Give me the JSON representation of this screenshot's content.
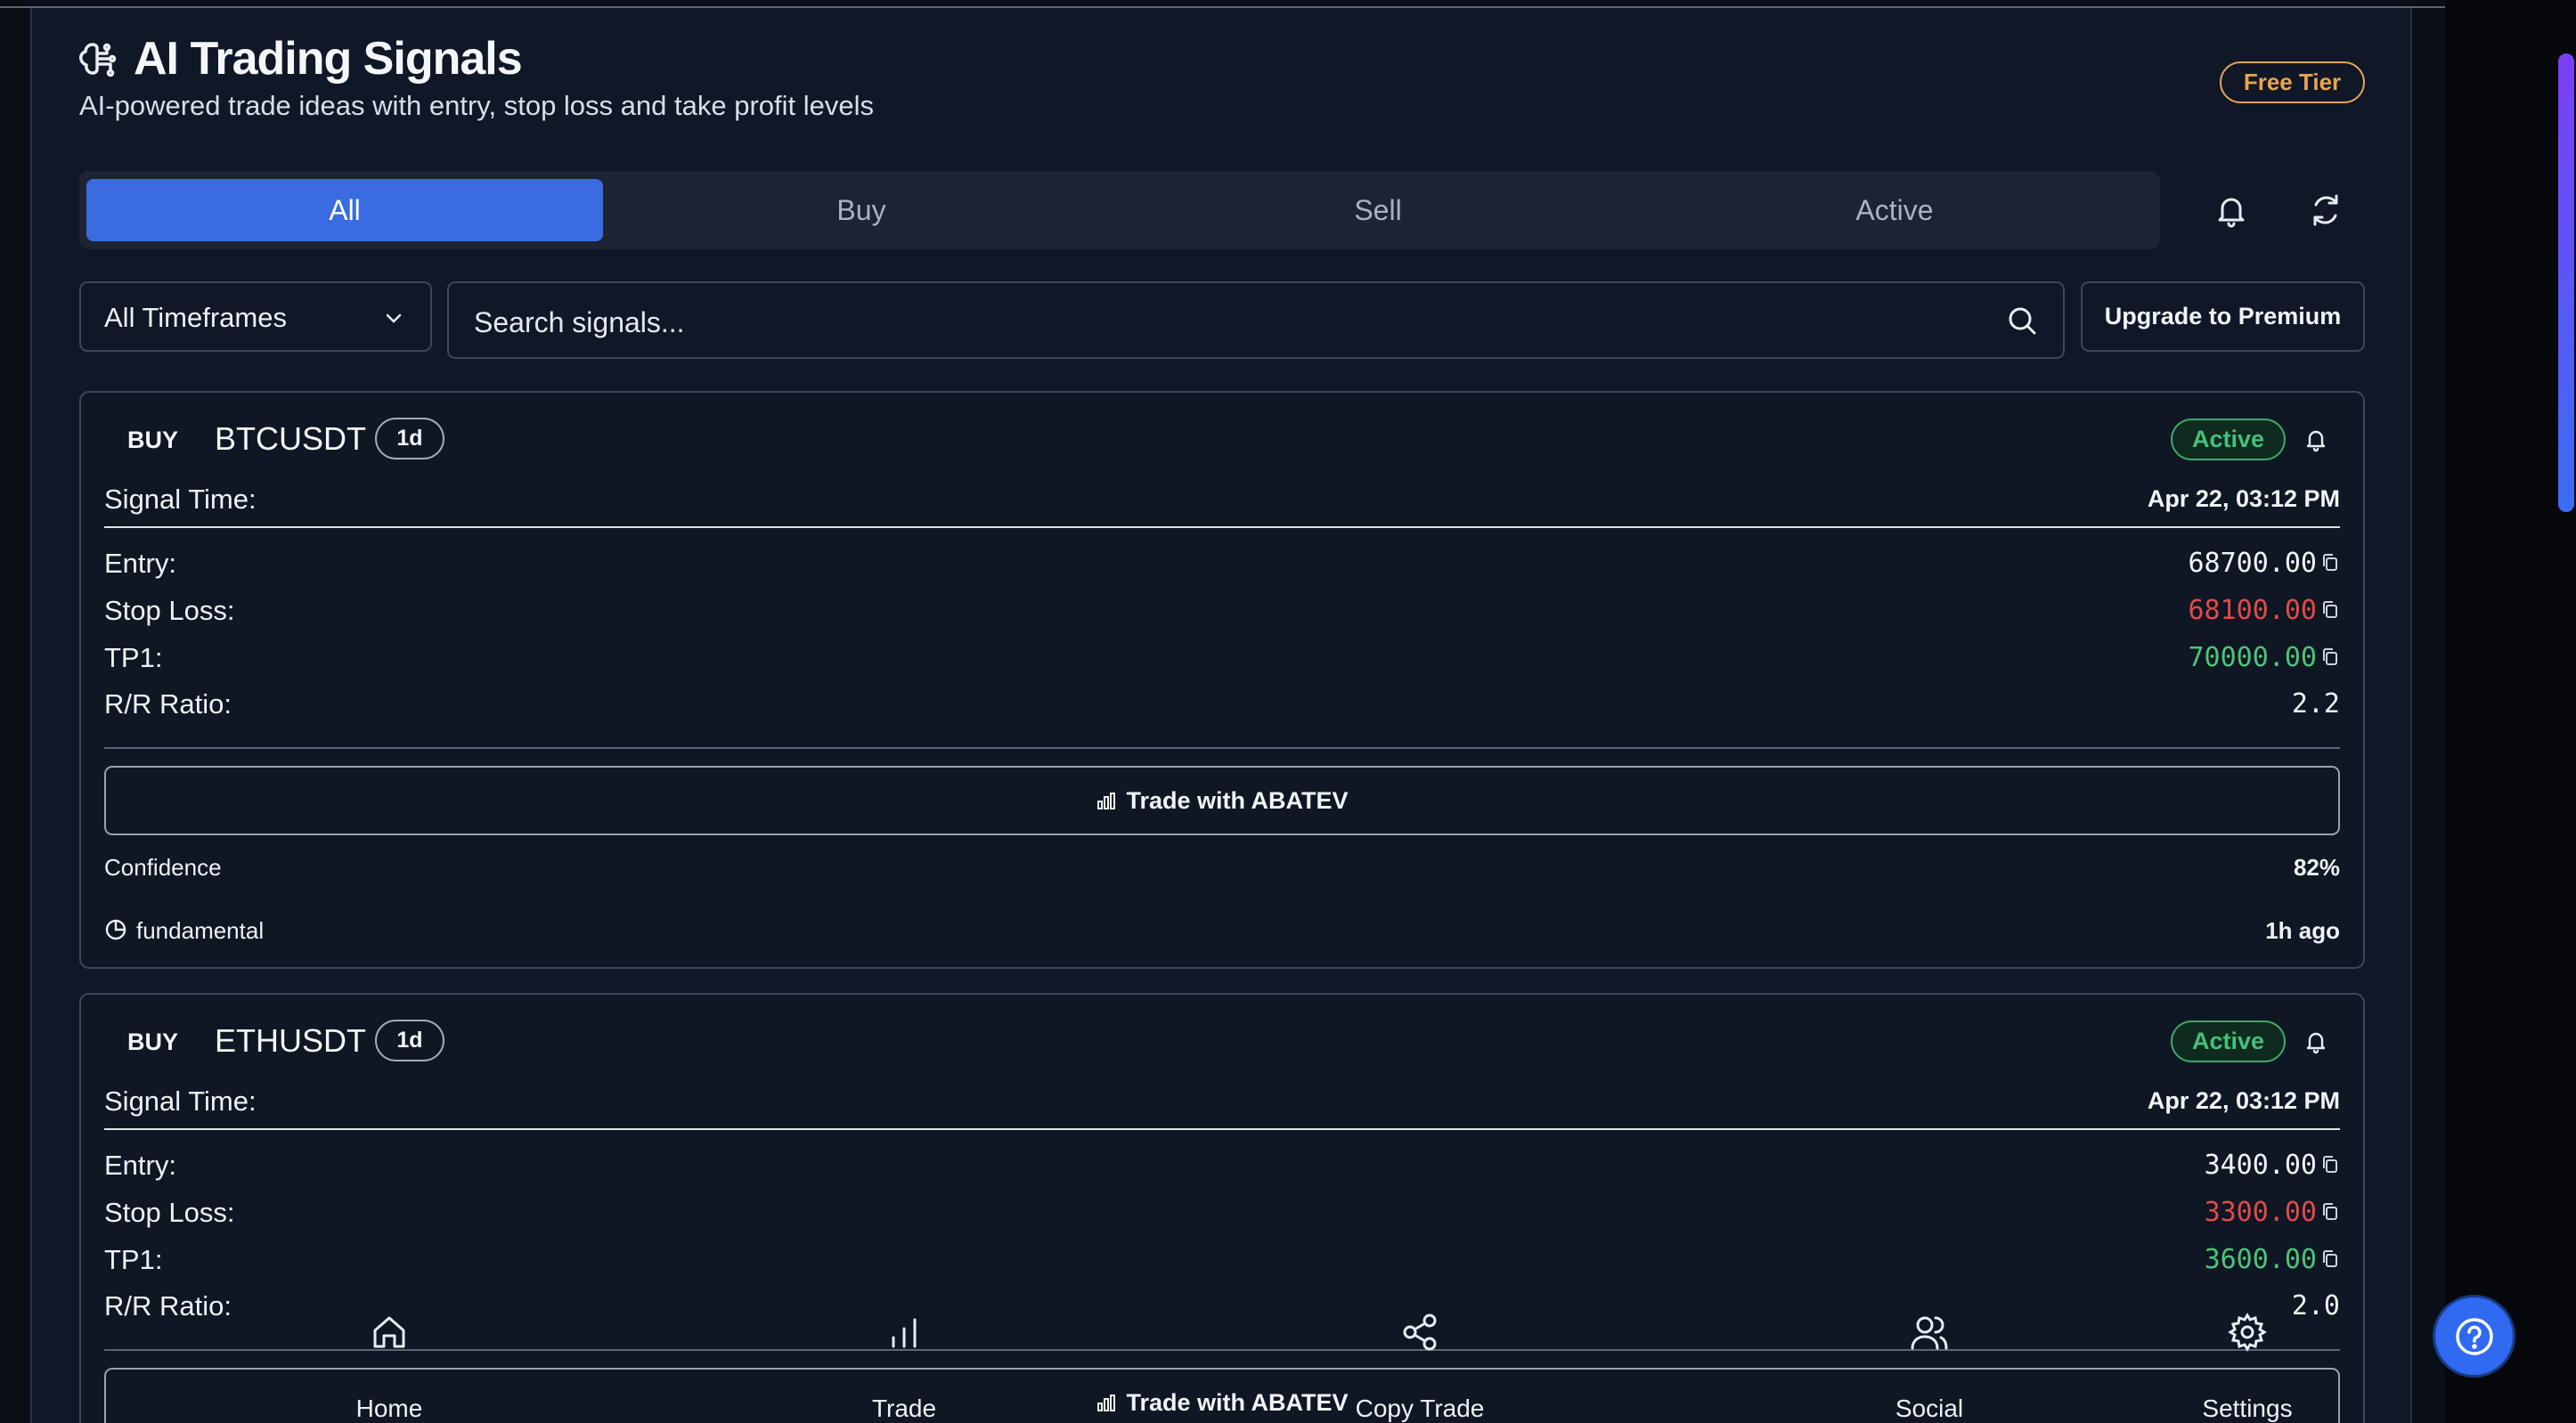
{
  "header": {
    "title": "AI Trading Signals",
    "subtitle": "AI-powered trade ideas with entry, stop loss and take profit levels",
    "tier_badge": "Free Tier",
    "title_icon": "brain-icon"
  },
  "tabs": [
    {
      "label": "All",
      "active": true
    },
    {
      "label": "Buy",
      "active": false
    },
    {
      "label": "Sell",
      "active": false
    },
    {
      "label": "Active",
      "active": false
    }
  ],
  "toolbar": {
    "notifications_icon": "bell-icon",
    "refresh_icon": "refresh-icon",
    "timeframe_selected": "All Timeframes",
    "search_placeholder": "Search signals...",
    "upgrade_label": "Upgrade to Premium"
  },
  "signals": [
    {
      "type": "BUY",
      "symbol": "BTCUSDT",
      "timeframe": "1d",
      "status": "Active",
      "signal_time_label": "Signal Time:",
      "signal_time": "Apr 22, 03:12 PM",
      "entry_label": "Entry:",
      "entry": "68700.00",
      "stop_loss_label": "Stop Loss:",
      "stop_loss": "68100.00",
      "tp1_label": "TP1:",
      "tp1": "70000.00",
      "rr_label": "R/R Ratio:",
      "rr": "2.2",
      "trade_label": "Trade with ABATEV",
      "confidence_label": "Confidence",
      "confidence": "82%",
      "source": "fundamental",
      "age": "1h ago"
    },
    {
      "type": "BUY",
      "symbol": "ETHUSDT",
      "timeframe": "1d",
      "status": "Active",
      "signal_time_label": "Signal Time:",
      "signal_time": "Apr 22, 03:12 PM",
      "entry_label": "Entry:",
      "entry": "3400.00",
      "stop_loss_label": "Stop Loss:",
      "stop_loss": "3300.00",
      "tp1_label": "TP1:",
      "tp1": "3600.00",
      "rr_label": "R/R Ratio:",
      "rr": "2.0",
      "trade_label": "Trade with ABATEV"
    }
  ],
  "bottom_nav": [
    {
      "label": "Home",
      "icon": "home-icon"
    },
    {
      "label": "Trade",
      "icon": "bar-chart-icon"
    },
    {
      "label": "Copy Trade",
      "icon": "share-icon"
    },
    {
      "label": "Social",
      "icon": "users-icon"
    },
    {
      "label": "Settings",
      "icon": "gear-icon"
    }
  ],
  "help_icon": "help-icon",
  "colors": {
    "background": "#101726",
    "accent": "#3a6be0",
    "positive": "#4cc477",
    "negative": "#e04b48",
    "tier": "#e9a44f"
  }
}
